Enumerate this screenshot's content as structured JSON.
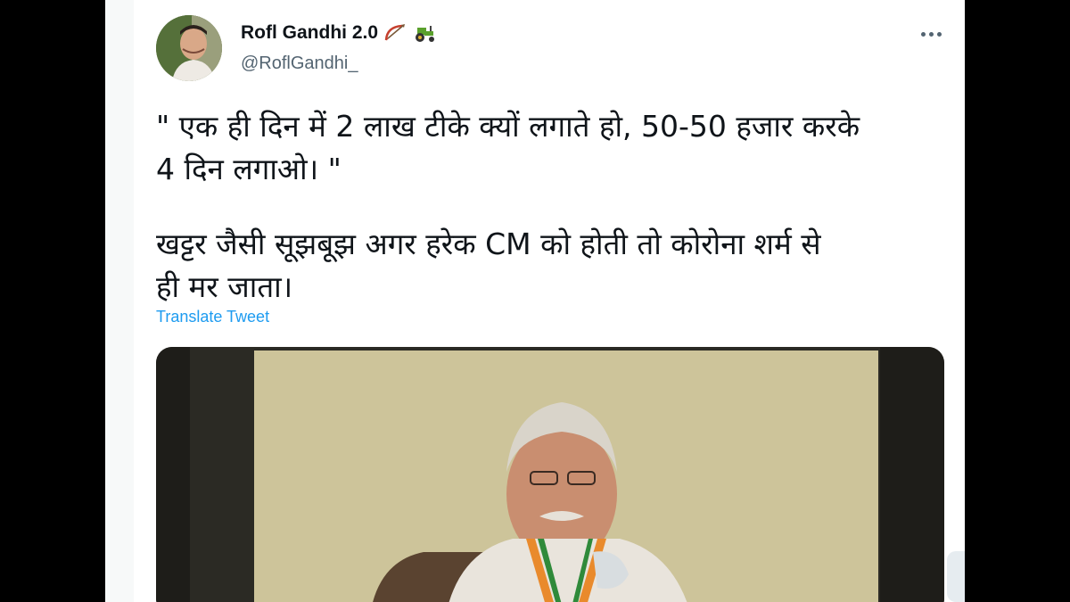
{
  "tweet": {
    "display_name": "Rofl Gandhi 2.0",
    "name_emojis": [
      "bow-and-arrow-icon",
      "tractor-icon"
    ],
    "handle": "@RoflGandhi_",
    "more_icon": "ellipsis-icon",
    "text_line1": "\" एक ही दिन में 2 लाख टीके क्यों लगाते हो, 50-50 हजार करके",
    "text_line2": "4 दिन लगाओ। \"",
    "text_line3": "खट्टर जैसी सूझबूझ अगर हरेक CM को होती तो कोरोना शर्म से",
    "text_line4": "ही मर जाता।",
    "translate_label": "Translate Tweet",
    "media": {
      "type": "video-thumbnail"
    }
  },
  "colors": {
    "link": "#1d9bf0",
    "text": "#0f1419",
    "muted": "#536471",
    "letterbox": "#000000"
  }
}
